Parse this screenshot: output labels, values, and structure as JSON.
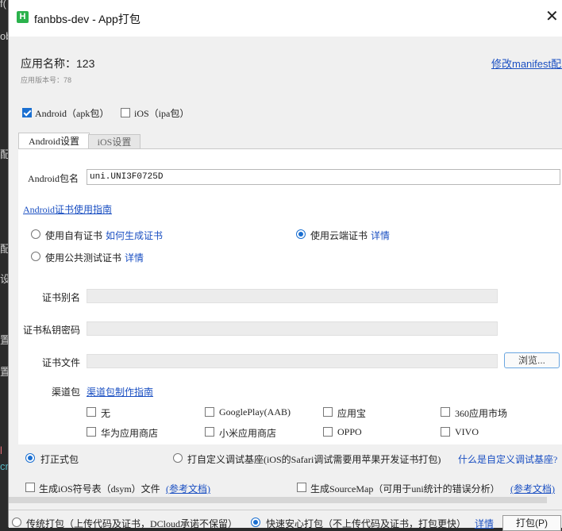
{
  "window": {
    "title": "fanbbs-dev - App打包",
    "logo": "H"
  },
  "app": {
    "name": "应用名称：123",
    "version": "应用版本号：78"
  },
  "manifest_link": "修改manifest配置",
  "platforms": {
    "android": "Android（apk包）",
    "ios": "iOS（ipa包）"
  },
  "tabs": {
    "android": "Android设置",
    "ios": "iOS设置"
  },
  "package": {
    "label": "Android包名",
    "value": "uni.UNI3F0725D"
  },
  "cert_guide": "Android证书使用指南",
  "cert_options": {
    "own": "使用自有证书",
    "how_to": "如何生成证书",
    "cloud": "使用云端证书",
    "cloud_detail": "详情",
    "public": "使用公共测试证书",
    "public_detail": "详情"
  },
  "fields": {
    "alias": "证书别名",
    "password": "证书私钥密码",
    "file": "证书文件",
    "browse": "浏览..."
  },
  "channel": {
    "label": "渠道包",
    "guide": "渠道包制作指南",
    "items": [
      "无",
      "GooglePlay(AAB)",
      "应用宝",
      "360应用市场",
      "华为应用商店",
      "小米应用商店",
      "OPPO",
      "VIVO"
    ]
  },
  "build_type": {
    "formal": "打正式包",
    "custom": "打自定义调试基座(iOS的Safari调试需要用苹果开发证书打包)",
    "what_is": "什么是自定义调试基座?"
  },
  "options": {
    "dsym": "生成iOS符号表（dsym）文件",
    "dsym_doc": "(参考文档)",
    "sourcemap": "生成SourceMap（可用于uni统计的错误分析）",
    "sourcemap_doc": "(参考文档)"
  },
  "pack_mode": {
    "traditional": "传统打包（上传代码及证书，DCloud承诺不保留）",
    "fast": "快速安心打包（不上传代码及证书，打包更快）",
    "detail": "详情",
    "button": "打包(P)"
  },
  "background": {
    "chars": [
      "f(",
      "ob",
      "配",
      "配",
      "设",
      "置",
      "置",
      "l",
      "cr"
    ]
  },
  "colors": {
    "accent": "#1a6fd1",
    "link": "#1a4fc2",
    "logo": "#2bb24c"
  }
}
